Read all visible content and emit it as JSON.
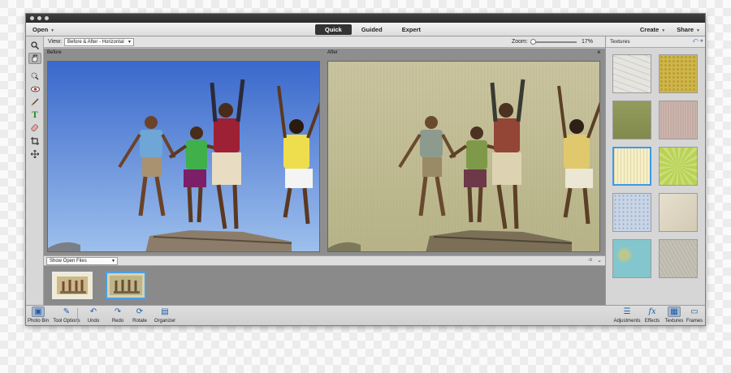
{
  "menubar": {
    "open_label": "Open",
    "modes": [
      "Quick",
      "Guided",
      "Expert"
    ],
    "active_mode": "Quick",
    "create_label": "Create",
    "share_label": "Share"
  },
  "options": {
    "view_label": "View:",
    "view_value": "Before & After - Horizontal",
    "zoom_label": "Zoom:",
    "zoom_value": "17%",
    "zoom_fraction": 0.0
  },
  "canvas": {
    "before_label": "Before",
    "after_label": "After"
  },
  "photo_bin": {
    "select_value": "Show Open Files",
    "thumbnail_count": 2,
    "selected_thumbnail": 1
  },
  "panel": {
    "title": "Textures",
    "textures": [
      {
        "name": "cracked-white",
        "color": "#e6e4df",
        "selected": false
      },
      {
        "name": "gold-dots",
        "color": "#cfb648",
        "selected": false
      },
      {
        "name": "olive",
        "color": "#8d9553",
        "selected": false
      },
      {
        "name": "pink-grain",
        "color": "#c4aba3",
        "selected": false
      },
      {
        "name": "cream-lines",
        "color": "#f6efc6",
        "selected": true
      },
      {
        "name": "lime-burst",
        "color": "#b9d253",
        "selected": false
      },
      {
        "name": "blue-speckle",
        "color": "#c8d5e6",
        "selected": false
      },
      {
        "name": "beige-wash",
        "color": "#ded5bd",
        "selected": false
      },
      {
        "name": "aqua-grunge",
        "color": "#84c6cd",
        "selected": false
      },
      {
        "name": "grey-stone",
        "color": "#bdb9ad",
        "selected": false
      }
    ]
  },
  "taskbar": {
    "left": [
      {
        "label": "Photo Bin",
        "icon": "photo-bin-icon",
        "selected": true
      },
      {
        "label": "Tool Options",
        "icon": "tool-options-icon",
        "selected": false
      },
      {
        "label": "Undo",
        "icon": "undo-icon",
        "selected": false
      },
      {
        "label": "Redo",
        "icon": "redo-icon",
        "selected": false
      },
      {
        "label": "Rotate",
        "icon": "rotate-icon",
        "selected": false
      },
      {
        "label": "Organizer",
        "icon": "organizer-icon",
        "selected": false
      }
    ],
    "right": [
      {
        "label": "Adjustments",
        "icon": "adjustments-icon",
        "selected": false
      },
      {
        "label": "Effects",
        "icon": "effects-icon",
        "selected": false
      },
      {
        "label": "Textures",
        "icon": "textures-icon",
        "selected": true
      },
      {
        "label": "Frames",
        "icon": "frames-icon",
        "selected": false
      }
    ]
  },
  "colors": {
    "accent": "#3d9ae8",
    "sky_top": "#3f6fd0",
    "sky_bottom": "#8fb6ea",
    "sepia_light": "#c8c39a",
    "sepia_dark": "#8c8760"
  }
}
